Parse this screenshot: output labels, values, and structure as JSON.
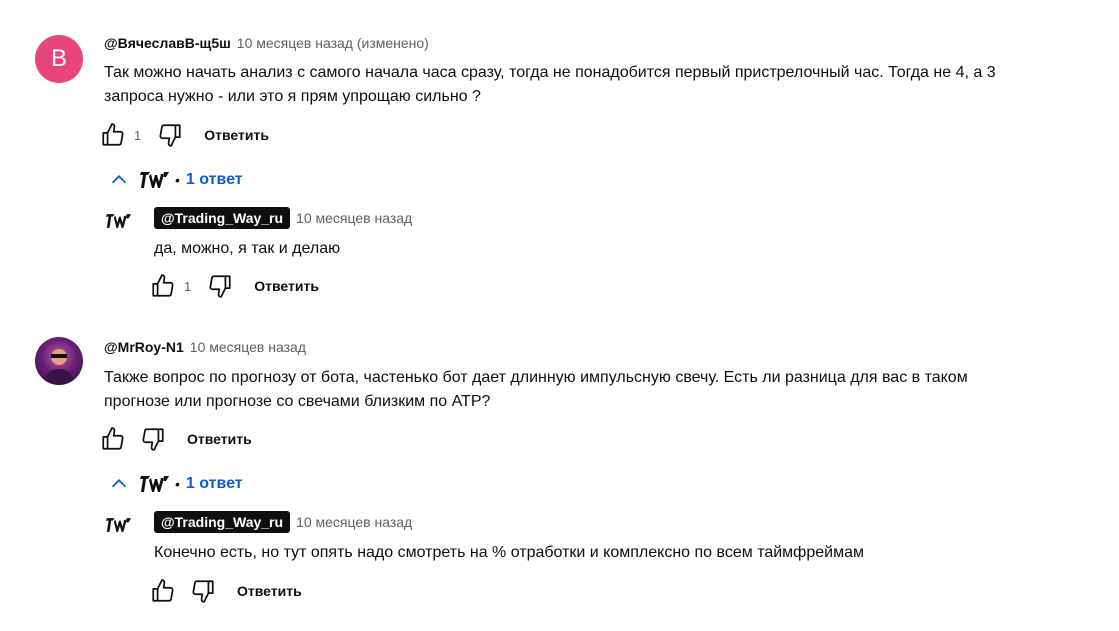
{
  "comments": [
    {
      "avatar_letter": "В",
      "avatar_color": "#e8457a",
      "author": "@ВячеславВ-щ5ш",
      "meta": "10 месяцев назад (изменено)",
      "text_line1": "Так можно начать анализ с самого начала часа сразу, тогда не понадобится первый пристрелочный час. Тогда не 4, а 3",
      "text_line2": "запроса нужно - или это я прям упрощаю сильно ?",
      "likes": "1",
      "reply_label": "Ответить",
      "replies_toggle": "1 ответ",
      "reply": {
        "author": "@Trading_Way_ru",
        "meta": "10 месяцев назад",
        "text": "да, можно, я так и делаю",
        "likes": "1",
        "reply_label": "Ответить"
      }
    },
    {
      "author": "@MrRoy-N1",
      "meta": "10 месяцев назад",
      "text_line1": "Также вопрос по прогнозу от бота, частенько бот дает длинную импульсную свечу. Есть ли разница для вас в таком",
      "text_line2": "прогнозе или прогнозе со свечами близким по АТР?",
      "reply_label": "Ответить",
      "replies_toggle": "1 ответ",
      "reply": {
        "author": "@Trading_Way_ru",
        "meta": "10 месяцев назад",
        "text": "Конечно есть, но тут опять надо смотреть на % отработки и комплексно по всем таймфреймам",
        "reply_label": "Ответить"
      }
    }
  ],
  "separator_dot": "•",
  "icons": {
    "like": "thumbs-up-icon",
    "dislike": "thumbs-down-icon",
    "collapse": "chevron-up-icon",
    "channel_logo": "trading-way-logo"
  },
  "colors": {
    "link_blue": "#065fd4",
    "chip_bg": "#0f0f0f",
    "meta_gray": "#606060"
  }
}
